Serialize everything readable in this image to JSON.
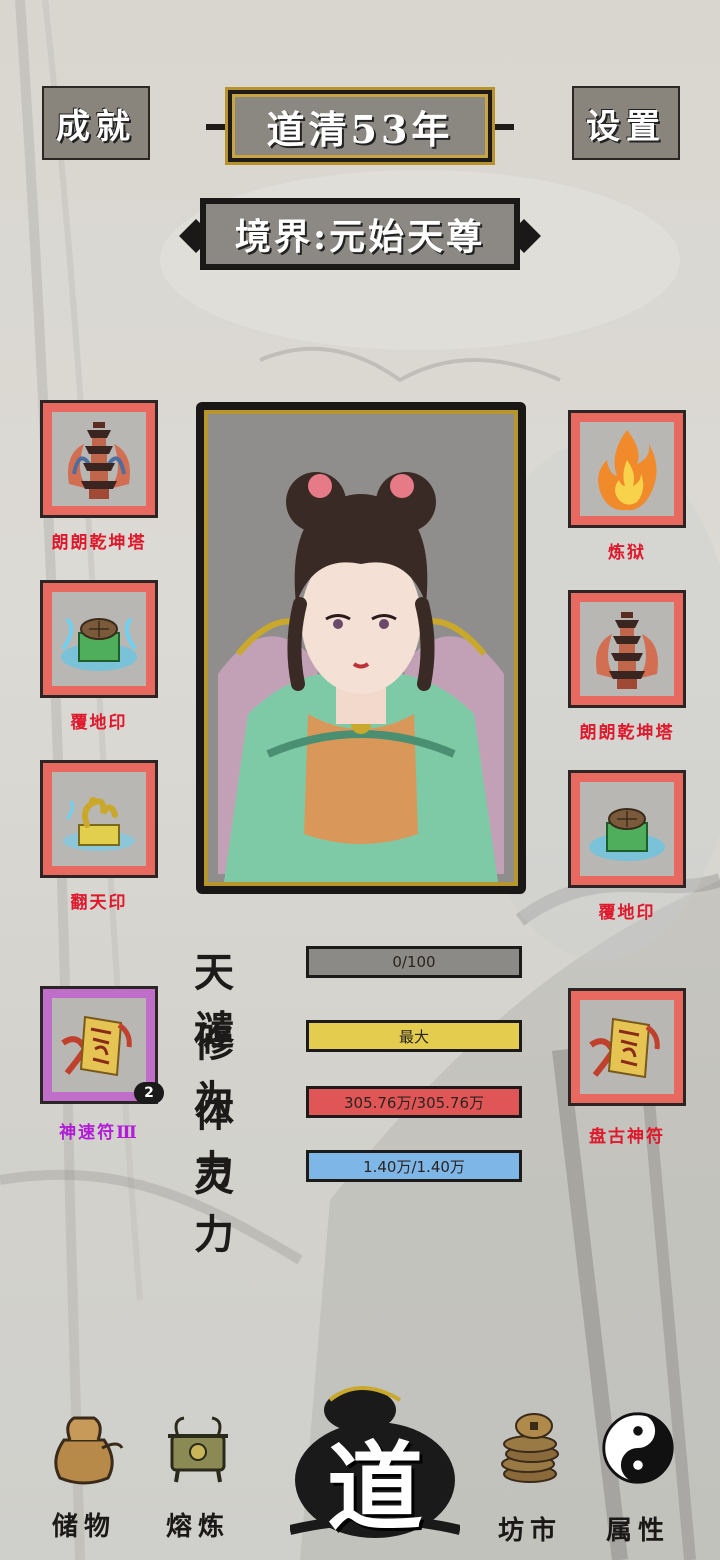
{
  "header": {
    "achievements_label": "成就",
    "year_title": "道清53年",
    "settings_label": "设置"
  },
  "realm": {
    "label": "境界:元始天尊"
  },
  "left_slots": [
    {
      "name": "朗朗乾坤塔",
      "icon": "pagoda-icon",
      "color": "#e0182c"
    },
    {
      "name": "覆地印",
      "icon": "turtle-seal-icon",
      "color": "#e0182c"
    },
    {
      "name": "翻天印",
      "icon": "dragon-seal-icon",
      "color": "#e0182c"
    },
    {
      "name": "神速符Ⅲ",
      "icon": "talisman-icon",
      "color": "#b21bd8",
      "count": "2"
    }
  ],
  "right_slots": [
    {
      "name": "炼狱",
      "icon": "flame-icon",
      "color": "#e0182c"
    },
    {
      "name": "朗朗乾坤塔",
      "icon": "pagoda-icon",
      "color": "#e0182c"
    },
    {
      "name": "覆地印",
      "icon": "turtle-seal-icon",
      "color": "#e0182c"
    },
    {
      "name": "盘古神符",
      "icon": "talisman-icon",
      "color": "#e0182c"
    }
  ],
  "stats": [
    {
      "label": "天谴",
      "value": "0/100",
      "fill": 0,
      "color": "#8c8a87"
    },
    {
      "label": "修为",
      "value": "最大",
      "fill": 1,
      "color": "#e3cc4e"
    },
    {
      "label": "体力",
      "value": "305.76万/305.76万",
      "fill": 1,
      "color": "#e05656"
    },
    {
      "label": "灵力",
      "value": "1.40万/1.40万",
      "fill": 1,
      "color": "#7fb6e8"
    }
  ],
  "nav": {
    "storage": "储物",
    "smelting": "熔炼",
    "dao": "道",
    "market": "坊市",
    "attributes": "属性"
  }
}
